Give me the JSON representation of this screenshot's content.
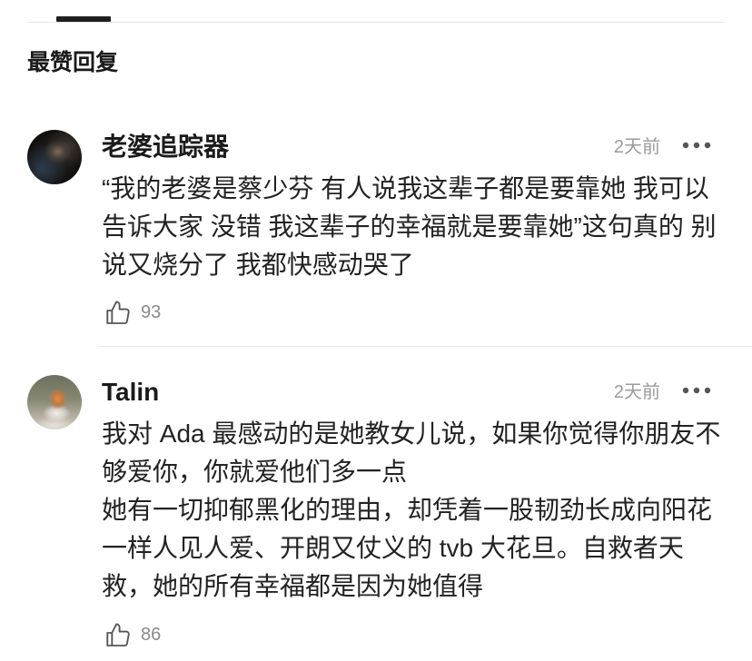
{
  "section": {
    "title": "最赞回复"
  },
  "colors": {
    "text": "#1f1f1f",
    "muted": "#9b9b9b",
    "divider": "#e9e9e9",
    "tab_indicator": "#1e1e1e"
  },
  "icons": {
    "like": "thumbs-up-icon",
    "more": "more-horizontal-icon"
  },
  "comments": [
    {
      "username": "老婆追踪器",
      "time": "2天前",
      "content": "“我的老婆是蔡少芬 有人说我这辈子都是要靠她 我可以告诉大家 没错 我这辈子的幸福就是要靠她”这句真的 别说又烧分了 我都快感动哭了",
      "likes": "93"
    },
    {
      "username": "Talin",
      "time": "2天前",
      "content": "我对 Ada 最感动的是她教女儿说，如果你觉得你朋友不够爱你，你就爱他们多一点\n她有一切抑郁黑化的理由，却凭着一股韧劲长成向阳花一样人见人爱、开朗又仗义的 tvb 大花旦。自救者天救，她的所有幸福都是因为她值得",
      "likes": "86"
    }
  ]
}
